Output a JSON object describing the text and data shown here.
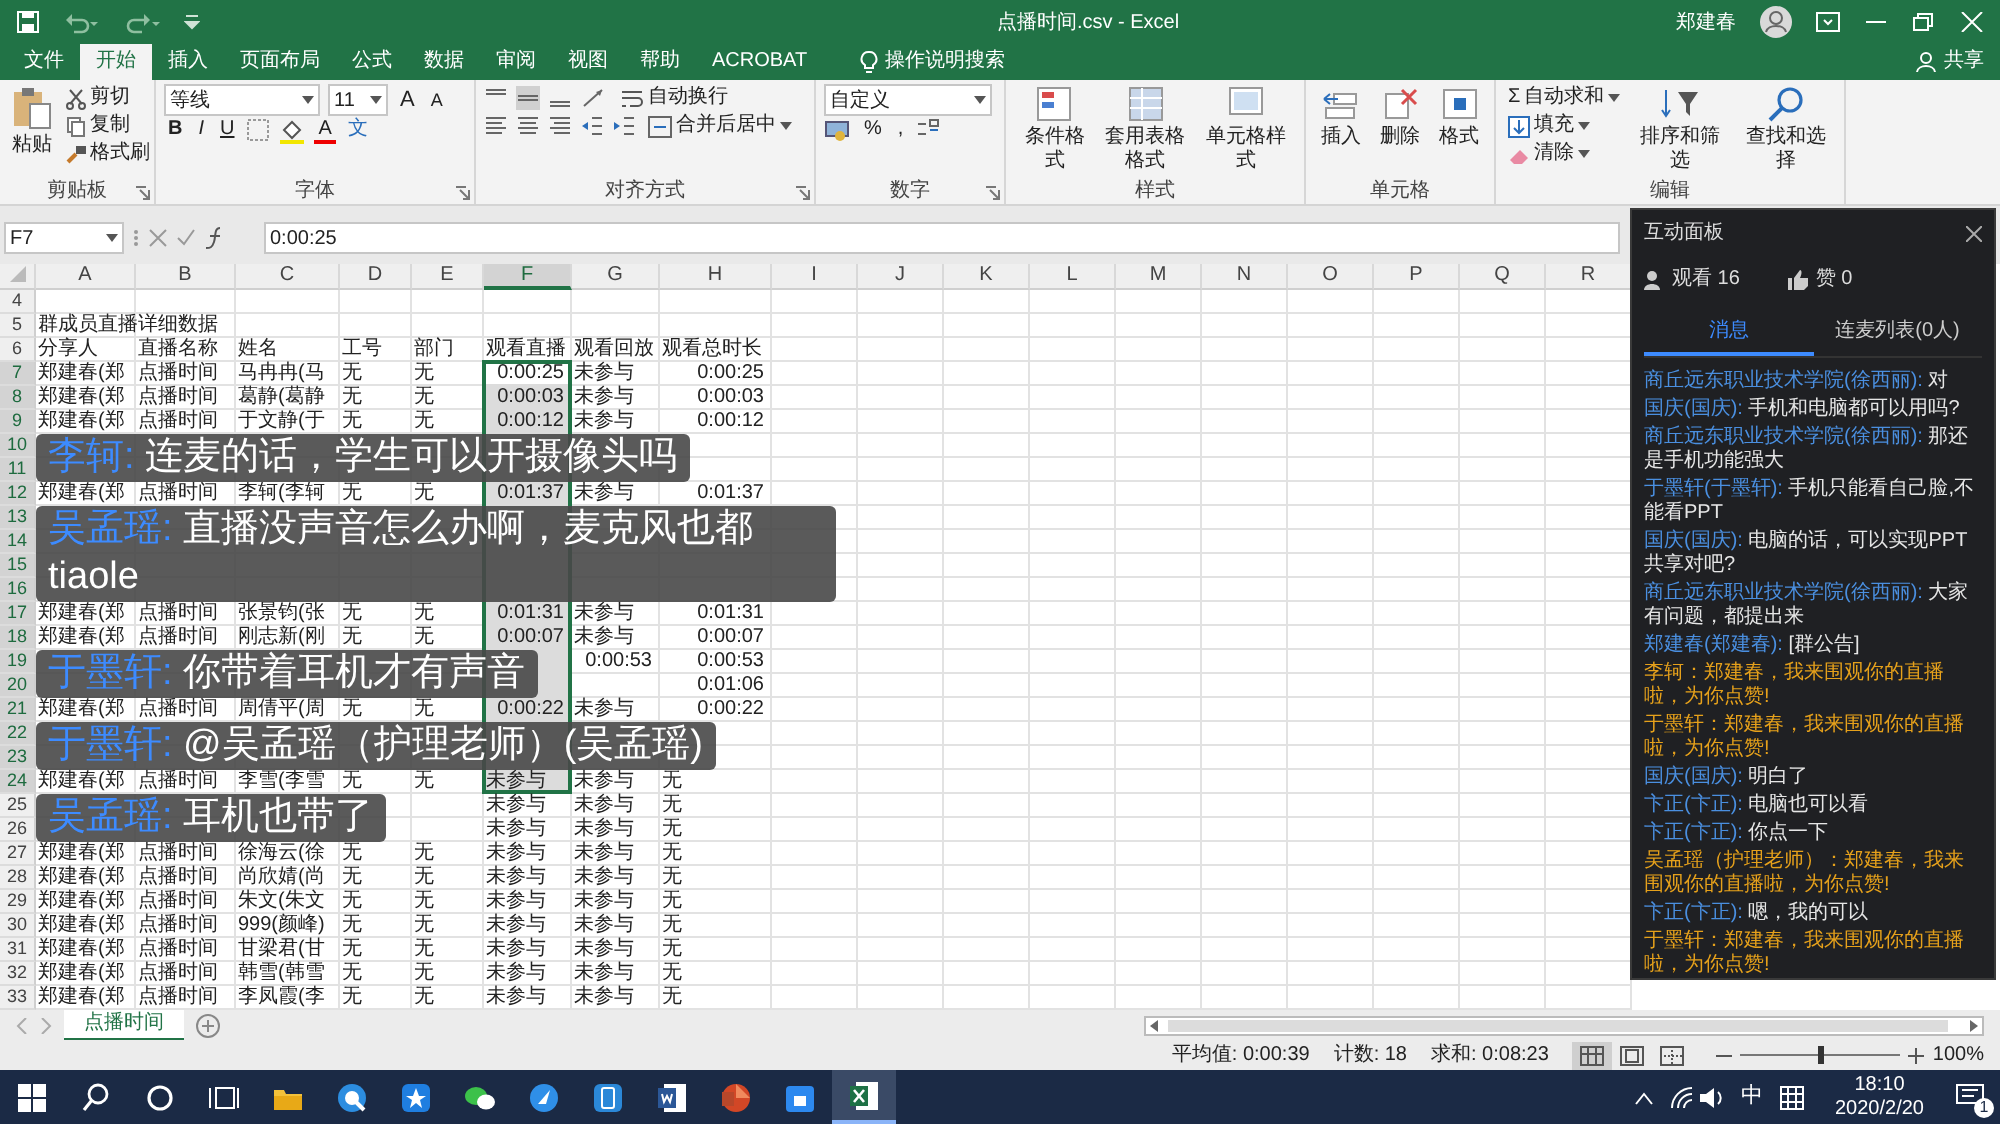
{
  "title_bar": {
    "title": "点播时间.csv - Excel",
    "user": "郑建春"
  },
  "ribbon_tabs": [
    {
      "label": "文件",
      "selected": false
    },
    {
      "label": "开始",
      "selected": true
    },
    {
      "label": "插入",
      "selected": false
    },
    {
      "label": "页面布局",
      "selected": false
    },
    {
      "label": "公式",
      "selected": false
    },
    {
      "label": "数据",
      "selected": false
    },
    {
      "label": "审阅",
      "selected": false
    },
    {
      "label": "视图",
      "selected": false
    },
    {
      "label": "帮助",
      "selected": false
    },
    {
      "label": "ACROBAT",
      "selected": false
    }
  ],
  "tell_me": "操作说明搜索",
  "share": "共享",
  "ribbon_groups": [
    {
      "kind": "clipboard",
      "label": "剪贴板",
      "big": "粘贴",
      "items": [
        "剪切",
        "复制",
        "格式刷"
      ]
    },
    {
      "kind": "font",
      "label": "字体",
      "font": "等线",
      "size": "11",
      "size_buttons": [
        "A",
        "A"
      ],
      "style_buttons": [
        "B",
        "I",
        "U"
      ],
      "color_button": "A",
      "phonetic_button": "文"
    },
    {
      "kind": "alignment",
      "label": "对齐方式",
      "items": [
        "自动换行",
        "合并后居中"
      ]
    },
    {
      "kind": "number",
      "label": "数字",
      "format": "自定义",
      "buttons": [
        "%",
        ","
      ]
    },
    {
      "kind": "styles",
      "label": "样式",
      "items": [
        "条件格式",
        "套用表格格式",
        "单元格样式"
      ]
    },
    {
      "kind": "cells",
      "label": "单元格",
      "items": [
        "插入",
        "删除",
        "格式"
      ]
    },
    {
      "kind": "editing",
      "label": "编辑",
      "sum_symbol": "Σ",
      "items": [
        "自动求和",
        "填充",
        "清除"
      ],
      "big": [
        "排序和筛选",
        "查找和选择"
      ]
    }
  ],
  "formula_bar": {
    "name_box": "F7",
    "value": "0:00:25"
  },
  "sheet": {
    "columns": [
      {
        "label": "A",
        "selected": false
      },
      {
        "label": "B",
        "selected": false
      },
      {
        "label": "C",
        "selected": false
      },
      {
        "label": "D",
        "selected": false
      },
      {
        "label": "E",
        "selected": false
      },
      {
        "label": "F",
        "selected": true
      },
      {
        "label": "G",
        "selected": false
      },
      {
        "label": "H",
        "selected": false
      },
      {
        "label": "I",
        "selected": false
      },
      {
        "label": "J",
        "selected": false
      },
      {
        "label": "K",
        "selected": false
      },
      {
        "label": "L",
        "selected": false
      },
      {
        "label": "M",
        "selected": false
      },
      {
        "label": "N",
        "selected": false
      },
      {
        "label": "O",
        "selected": false
      },
      {
        "label": "P",
        "selected": false
      },
      {
        "label": "Q",
        "selected": false
      },
      {
        "label": "R",
        "selected": false
      }
    ],
    "rows": [
      {
        "label": "4",
        "selected": false
      },
      {
        "label": "5",
        "selected": false,
        "cells": {
          "A": "群成员直播详细数据"
        }
      },
      {
        "label": "6",
        "selected": false,
        "cells": {
          "A": "分享人",
          "B": "直播名称",
          "C": "姓名",
          "D": "工号",
          "E": "部门",
          "F": "观看直播",
          "G": "观看回放",
          "H": "观看总时长"
        }
      },
      {
        "label": "7",
        "selected": true,
        "cells": {
          "A": "郑建春(郑",
          "B": "点播时间",
          "C": "马冉冉(马",
          "D": "无",
          "E": "无",
          "F": "0:00:25",
          "G": "未参与",
          "H": "0:00:25"
        }
      },
      {
        "label": "8",
        "selected": true,
        "cells": {
          "A": "郑建春(郑",
          "B": "点播时间",
          "C": "葛静(葛静",
          "D": "无",
          "E": "无",
          "F": "0:00:03",
          "G": "未参与",
          "H": "0:00:03"
        }
      },
      {
        "label": "9",
        "selected": true,
        "cells": {
          "A": "郑建春(郑",
          "B": "点播时间",
          "C": "于文静(于",
          "D": "无",
          "E": "无",
          "F": "0:00:12",
          "G": "未参与",
          "H": "0:00:12"
        }
      },
      {
        "label": "10",
        "selected": true
      },
      {
        "label": "11",
        "selected": true
      },
      {
        "label": "12",
        "selected": true,
        "cells": {
          "A": "郑建春(郑",
          "B": "点播时间",
          "C": "李轲(李轲",
          "D": "无",
          "E": "无",
          "F": "0:01:37",
          "G": "未参与",
          "H": "0:01:37"
        }
      },
      {
        "label": "13",
        "selected": true
      },
      {
        "label": "14",
        "selected": true
      },
      {
        "label": "15",
        "selected": true
      },
      {
        "label": "16",
        "selected": true
      },
      {
        "label": "17",
        "selected": true,
        "cells": {
          "A": "郑建春(郑",
          "B": "点播时间",
          "C": "张景钧(张",
          "D": "无",
          "E": "无",
          "F": "0:01:31",
          "G": "未参与",
          "H": "0:01:31"
        }
      },
      {
        "label": "18",
        "selected": true,
        "cells": {
          "A": "郑建春(郑",
          "B": "点播时间",
          "C": "刚志新(刚",
          "D": "无",
          "E": "无",
          "F": "0:00:07",
          "G": "未参与",
          "H": "0:00:07"
        }
      },
      {
        "label": "19",
        "selected": true,
        "cells": {
          "G": "0:00:53",
          "H": "0:00:53"
        }
      },
      {
        "label": "20",
        "selected": true,
        "cells": {
          "H": "0:01:06"
        }
      },
      {
        "label": "21",
        "selected": true,
        "cells": {
          "A": "郑建春(郑",
          "B": "点播时间",
          "C": "周倩平(周",
          "D": "无",
          "E": "无",
          "F": "0:00:22",
          "G": "未参与",
          "H": "0:00:22"
        }
      },
      {
        "label": "22",
        "selected": true
      },
      {
        "label": "23",
        "selected": true
      },
      {
        "label": "24",
        "selected": true,
        "cells": {
          "A": "郑建春(郑",
          "B": "点播时间",
          "C": "李雪(李雪",
          "D": "无",
          "E": "无",
          "F": "未参与",
          "G": "未参与",
          "H": "无"
        }
      },
      {
        "label": "25",
        "selected": false,
        "cells": {
          "F": "未参与",
          "G": "未参与",
          "H": "无"
        }
      },
      {
        "label": "26",
        "selected": false,
        "cells": {
          "F": "未参与",
          "G": "未参与",
          "H": "无"
        }
      },
      {
        "label": "27",
        "selected": false,
        "cells": {
          "A": "郑建春(郑",
          "B": "点播时间",
          "C": "徐海云(徐",
          "D": "无",
          "E": "无",
          "F": "未参与",
          "G": "未参与",
          "H": "无"
        }
      },
      {
        "label": "28",
        "selected": false,
        "cells": {
          "A": "郑建春(郑",
          "B": "点播时间",
          "C": "尚欣婧(尚",
          "D": "无",
          "E": "无",
          "F": "未参与",
          "G": "未参与",
          "H": "无"
        }
      },
      {
        "label": "29",
        "selected": false,
        "cells": {
          "A": "郑建春(郑",
          "B": "点播时间",
          "C": "朱文(朱文",
          "D": "无",
          "E": "无",
          "F": "未参与",
          "G": "未参与",
          "H": "无"
        }
      },
      {
        "label": "30",
        "selected": false,
        "cells": {
          "A": "郑建春(郑",
          "B": "点播时间",
          "C": "999(颜峰)",
          "D": "无",
          "E": "无",
          "F": "未参与",
          "G": "未参与",
          "H": "无"
        }
      },
      {
        "label": "31",
        "selected": false,
        "cells": {
          "A": "郑建春(郑",
          "B": "点播时间",
          "C": "甘梁君(甘",
          "D": "无",
          "E": "无",
          "F": "未参与",
          "G": "未参与",
          "H": "无"
        }
      },
      {
        "label": "32",
        "selected": false,
        "cells": {
          "A": "郑建春(郑",
          "B": "点播时间",
          "C": "韩雪(韩雪",
          "D": "无",
          "E": "无",
          "F": "未参与",
          "G": "未参与",
          "H": "无"
        }
      },
      {
        "label": "33",
        "selected": false,
        "cells": {
          "A": "郑建春(郑",
          "B": "点播时间",
          "C": "李凤霞(李",
          "D": "无",
          "E": "无",
          "F": "未参与",
          "G": "未参与",
          "H": "无"
        }
      }
    ]
  },
  "captions": [
    {
      "speaker": "李轲:",
      "text": "连麦的话，学生可以开摄像头吗"
    },
    {
      "speaker": "吴孟瑶:",
      "text": "直播没声音怎么办啊，麦克风也都 tiaole"
    },
    {
      "speaker": "于墨轩:",
      "text": "你带着耳机才有声音"
    },
    {
      "speaker": "于墨轩:",
      "text": "@吴孟瑶（护理老师）(吴孟瑶)"
    },
    {
      "speaker": "吴孟瑶:",
      "text": "耳机也带了"
    }
  ],
  "panel": {
    "title": "互动面板",
    "stats": [
      {
        "kind": "viewers",
        "label": "观看 16"
      },
      {
        "kind": "likes",
        "label": "赞 0"
      }
    ],
    "tabs": [
      {
        "label": "消息",
        "selected": true
      },
      {
        "label": "连麦列表(0人)",
        "selected": false
      }
    ],
    "messages": [
      {
        "kind": "chat",
        "sender": "商丘远东职业技术学院(徐西丽):",
        "text": "对"
      },
      {
        "kind": "chat",
        "sender": "国庆(国庆):",
        "text": "手机和电脑都可以用吗?"
      },
      {
        "kind": "chat",
        "sender": "商丘远东职业技术学院(徐西丽):",
        "text": "那还是手机功能强大"
      },
      {
        "kind": "chat",
        "sender": "于墨轩(于墨轩):",
        "text": "手机只能看自己脸,不能看PPT"
      },
      {
        "kind": "chat",
        "sender": "国庆(国庆):",
        "text": "电脑的话，可以实现PPT共享对吧?"
      },
      {
        "kind": "chat",
        "sender": "商丘远东职业技术学院(徐西丽):",
        "text": "大家有问题，都提出来"
      },
      {
        "kind": "chat",
        "sender": "郑建春(郑建春):",
        "text": "[群公告]"
      },
      {
        "kind": "notice",
        "text": "李轲：郑建春，我来围观你的直播啦，为你点赞!"
      },
      {
        "kind": "notice",
        "text": "于墨轩：郑建春，我来围观你的直播啦，为你点赞!"
      },
      {
        "kind": "chat",
        "sender": "国庆(国庆):",
        "text": "明白了"
      },
      {
        "kind": "chat",
        "sender": "卞正(卞正):",
        "text": "电脑也可以看"
      },
      {
        "kind": "chat",
        "sender": "卞正(卞正):",
        "text": "你点一下"
      },
      {
        "kind": "notice",
        "text": "吴孟瑶（护理老师）：郑建春，我来围观你的直播啦，为你点赞!"
      },
      {
        "kind": "chat",
        "sender": "卞正(卞正):",
        "text": "嗯，我的可以"
      },
      {
        "kind": "notice",
        "text": "于墨轩：郑建春，我来围观你的直播啦，为你点赞!"
      }
    ]
  },
  "sheet_tabs": [
    {
      "label": "点播时间",
      "selected": true
    }
  ],
  "status_bar": {
    "average": "平均值: 0:00:39",
    "count": "计数: 18",
    "sum": "求和: 0:08:23",
    "views": [
      {
        "kind": "normal",
        "selected": true
      },
      {
        "kind": "layout",
        "selected": false
      },
      {
        "kind": "break",
        "selected": false
      }
    ],
    "zoom": {
      "level": 0.5
    },
    "zoom_label": "100%"
  },
  "taskbar": {
    "ime": "中",
    "time": "18:10",
    "date": "2020/2/20",
    "notifications": "1"
  }
}
